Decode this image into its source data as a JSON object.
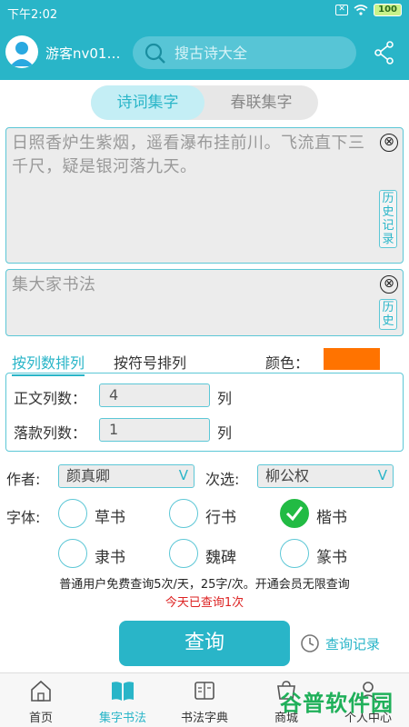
{
  "status": {
    "time": "下午2:02",
    "battery": "100"
  },
  "header": {
    "username": "游客nv014...",
    "search_placeholder": "搜古诗大全"
  },
  "segment": {
    "tabs": [
      "诗词集字",
      "春联集字"
    ]
  },
  "main_box": {
    "text": "日照香炉生紫烟，遥看瀑布挂前川。飞流直下三千尺，疑是银河落九天。",
    "clear": "⊗",
    "history": "历史记录"
  },
  "sign_box": {
    "placeholder": "集大家书法",
    "clear": "⊗",
    "history": "历史"
  },
  "sort": {
    "by_columns": "按列数排列",
    "by_symbol": "按符号排列",
    "color_label": "颜色：",
    "color_value": "#ff7300"
  },
  "columns": {
    "body_label": "正文列数：",
    "body_value": "4",
    "unit": "列",
    "sign_label": "落款列数：",
    "sign_value": "1"
  },
  "author": {
    "label": "作者:",
    "value": "颜真卿",
    "alt_label": "次选:",
    "alt_value": "柳公权",
    "arrow": "V"
  },
  "fonts": {
    "label": "字体:",
    "options": [
      {
        "name": "草书",
        "checked": false
      },
      {
        "name": "行书",
        "checked": false
      },
      {
        "name": "楷书",
        "checked": true
      },
      {
        "name": "隶书",
        "checked": false
      },
      {
        "name": "魏碑",
        "checked": false
      },
      {
        "name": "篆书",
        "checked": false
      }
    ]
  },
  "notice": {
    "line1": "普通用户免费查询5次/天，25字/次。开通会员无限查询",
    "line2": "今天已查询1次"
  },
  "actions": {
    "query": "查询",
    "history": "查询记录"
  },
  "nav": {
    "items": [
      "首页",
      "集字书法",
      "书法字典",
      "商城",
      "个人中心"
    ]
  },
  "watermark": {
    "text": "谷普软件园"
  }
}
